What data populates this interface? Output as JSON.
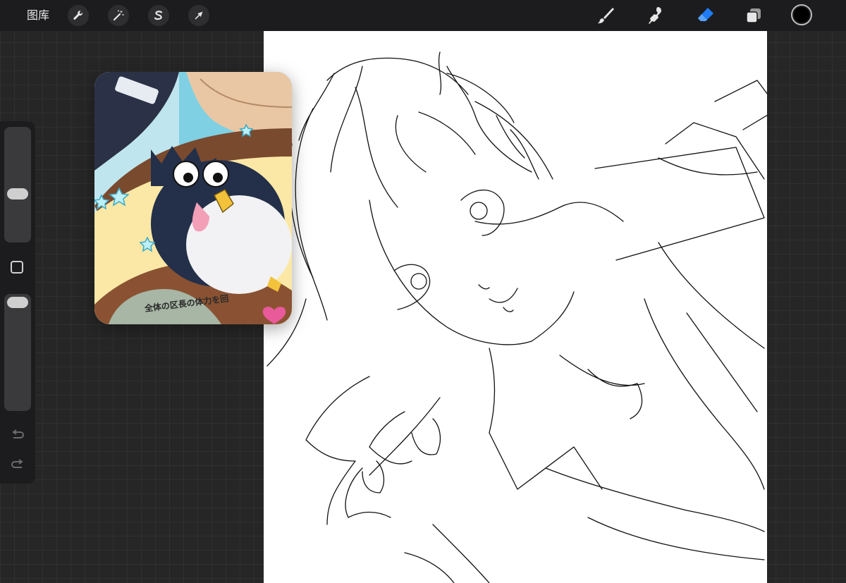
{
  "toolbar": {
    "gallery_label": "图库",
    "left_tools": [
      {
        "name": "wrench-icon",
        "label": "actions"
      },
      {
        "name": "magic-wand-icon",
        "label": "adjustments"
      },
      {
        "name": "selection-s-icon",
        "label": "selection"
      },
      {
        "name": "arrow-cursor-icon",
        "label": "transform"
      }
    ],
    "right_tools": [
      {
        "name": "brush-icon",
        "active": false
      },
      {
        "name": "smudge-icon",
        "active": false
      },
      {
        "name": "eraser-icon",
        "active": true
      },
      {
        "name": "layers-icon",
        "active": false
      }
    ],
    "accent_color": "#1f7cf5",
    "current_color": "#000000"
  },
  "sidebar": {
    "brush_size_level": 0.55,
    "opacity_level": 0.95,
    "modify_icon": "square-icon",
    "undo_icon": "undo-icon",
    "redo_icon": "redo-icon"
  },
  "reference": {
    "caption": "全体の区長の体力を回"
  }
}
